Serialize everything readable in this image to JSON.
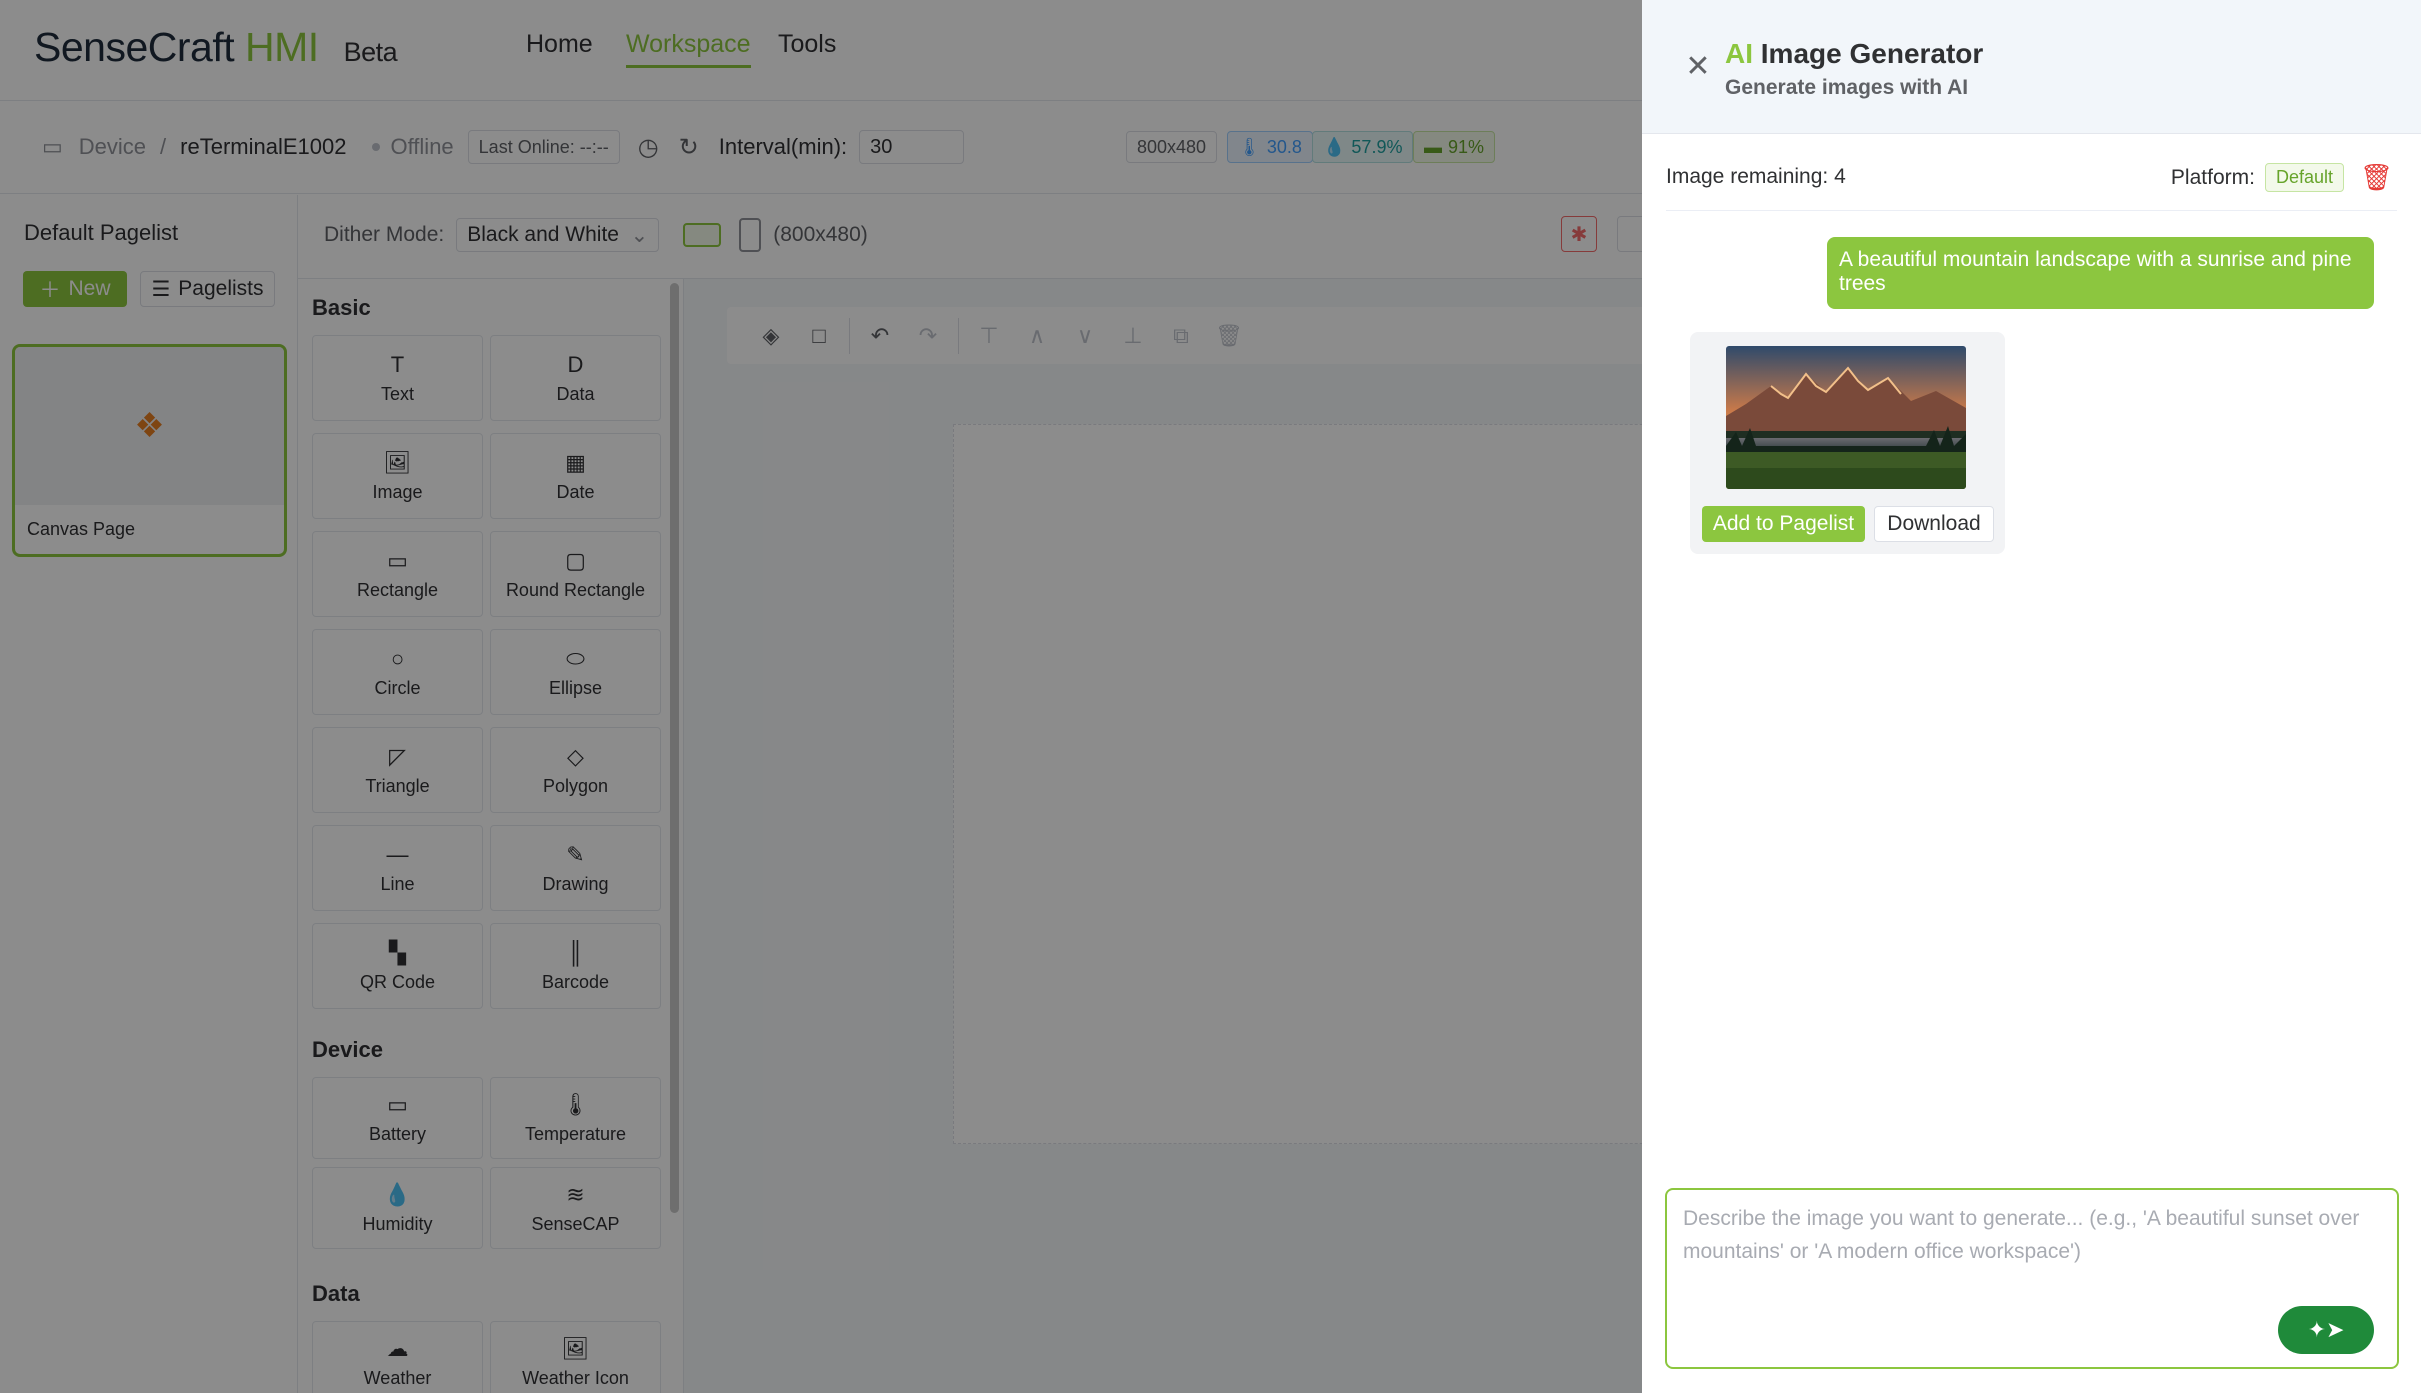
{
  "header": {
    "brand_main": "SenseCraft",
    "brand_hmi": "HMI",
    "brand_beta": "Beta",
    "nav": [
      {
        "label": "Home"
      },
      {
        "label": "Workspace"
      },
      {
        "label": "Tools"
      }
    ]
  },
  "device_bar": {
    "breadcrumb_root": "Device",
    "breadcrumb_sep": "/",
    "device_name": "reTerminalE1002",
    "status": "Offline",
    "last_online": "Last Online: --:--",
    "interval_label": "Interval(min):",
    "interval_value": "30",
    "resolution": "800x480",
    "temperature": "30.8",
    "humidity": "57.9%",
    "battery": "91%"
  },
  "sidebar": {
    "title": "Default Pagelist",
    "new_label": "New",
    "pagelists_label": "Pagelists",
    "page_card_label": "Canvas Page"
  },
  "toolbar": {
    "dither_label": "Dither Mode:",
    "dither_value": "Black and White",
    "size_label": "(800x480)"
  },
  "components": {
    "basic_title": "Basic",
    "device_title": "Device",
    "data_title": "Data",
    "basic": [
      {
        "label": "Text",
        "icon": "T"
      },
      {
        "label": "Data",
        "icon": "D"
      },
      {
        "label": "Image",
        "icon": "🖼"
      },
      {
        "label": "Date",
        "icon": "▦"
      },
      {
        "label": "Rectangle",
        "icon": "▭"
      },
      {
        "label": "Round Rectangle",
        "icon": "▢"
      },
      {
        "label": "Circle",
        "icon": "○"
      },
      {
        "label": "Ellipse",
        "icon": "⬭"
      },
      {
        "label": "Triangle",
        "icon": "◸"
      },
      {
        "label": "Polygon",
        "icon": "◇"
      },
      {
        "label": "Line",
        "icon": "—"
      },
      {
        "label": "Drawing",
        "icon": "✎"
      },
      {
        "label": "QR Code",
        "icon": "▚"
      },
      {
        "label": "Barcode",
        "icon": "║"
      }
    ],
    "device": [
      {
        "label": "Battery",
        "icon": "▭"
      },
      {
        "label": "Temperature",
        "icon": "🌡"
      },
      {
        "label": "Humidity",
        "icon": "💧"
      },
      {
        "label": "SenseCAP",
        "icon": "≋"
      }
    ],
    "data": [
      {
        "label": "Weather",
        "icon": "☁"
      },
      {
        "label": "Weather Icon",
        "icon": "🖼"
      }
    ]
  },
  "ai_drawer": {
    "title_ai": "AI",
    "title_rest": "Image Generator",
    "subtitle": "Generate images with AI",
    "remaining": "Image remaining: 4",
    "platform_label": "Platform:",
    "platform_value": "Default",
    "user_message": "A beautiful mountain landscape with a sunrise and pine trees",
    "add_to_pagelist": "Add to Pagelist",
    "download": "Download",
    "prompt_placeholder": "Describe the image you want to generate... (e.g., 'A beautiful sunset over mountains' or 'A modern office workspace')"
  },
  "colors": {
    "accent": "#8cc63f",
    "send_button": "#1f8a3a",
    "danger": "#e53935"
  }
}
